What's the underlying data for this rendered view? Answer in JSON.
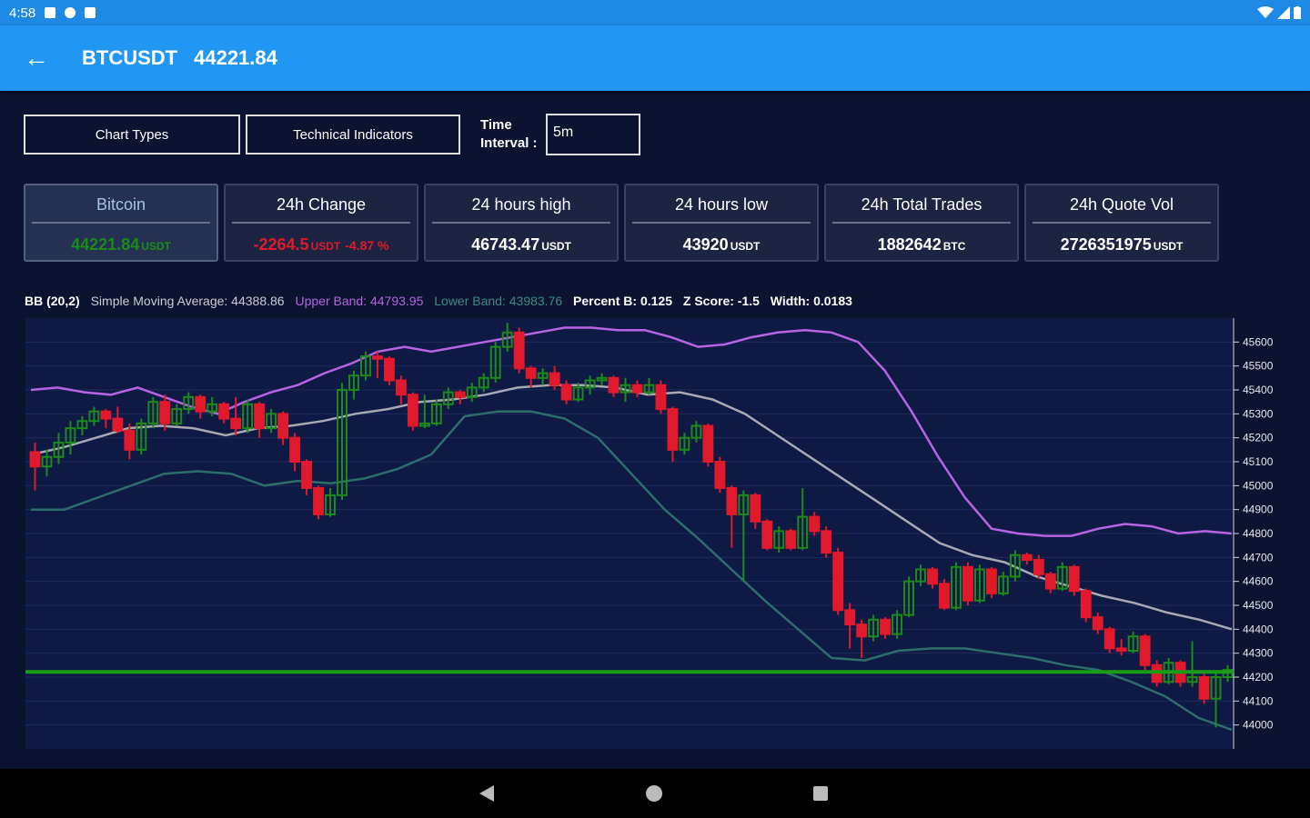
{
  "status_bar": {
    "time": "4:58"
  },
  "app_bar": {
    "symbol": "BTCUSDT",
    "price": "44221.84"
  },
  "toolbar": {
    "chart_types_label": "Chart Types",
    "technical_indicators_label": "Technical Indicators",
    "time_interval_label_line1": "Time",
    "time_interval_label_line2": "Interval :",
    "time_interval_value": "5m"
  },
  "stats": {
    "coin": {
      "title": "Bitcoin",
      "value": "44221.84",
      "unit": "USDT"
    },
    "change": {
      "title": "24h Change",
      "value": "-2264.5",
      "unit": "USDT",
      "percent": "-4.87 %"
    },
    "high": {
      "title": "24 hours high",
      "value": "46743.47",
      "unit": "USDT"
    },
    "low": {
      "title": "24 hours low",
      "value": "43920",
      "unit": "USDT"
    },
    "trades": {
      "title": "24h Total Trades",
      "value": "1882642",
      "unit": "BTC"
    },
    "quote_vol": {
      "title": "24h Quote Vol",
      "value": "2726351975",
      "unit": "USDT"
    }
  },
  "legend": {
    "bb": "BB (20,2)",
    "sma": "Simple Moving Average: 44388.86",
    "upper": "Upper Band: 44793.95",
    "lower": "Lower Band: 43983.76",
    "percent_b": "Percent B: 0.125",
    "z_score": "Z Score: -1.5",
    "width": "Width: 0.0183"
  },
  "colors": {
    "app_bar": "#2196f3",
    "background": "#0c1330",
    "chart_background": "#0e1a44",
    "candle_up": "#1c8a1c",
    "candle_down": "#e01a2c",
    "upper_band": "#b565e2",
    "sma": "#a9a9b3",
    "lower_band": "#2d6e6c",
    "price_line": "#1a9e1a"
  },
  "chart_data": {
    "type": "candlestick",
    "y_ticks": [
      44000,
      44100,
      44200,
      44300,
      44400,
      44500,
      44600,
      44700,
      44800,
      44900,
      45000,
      45100,
      45200,
      45300,
      45400,
      45500,
      45600
    ],
    "ylim": [
      43900,
      45700
    ],
    "current_price_line": 44221.84,
    "grid": true,
    "candles": [
      [
        45140,
        45080,
        45180,
        44980
      ],
      [
        45080,
        45120,
        45150,
        45040
      ],
      [
        45120,
        45180,
        45220,
        45090
      ],
      [
        45180,
        45240,
        45270,
        45130
      ],
      [
        45240,
        45270,
        45290,
        45210
      ],
      [
        45270,
        45310,
        45330,
        45250
      ],
      [
        45310,
        45280,
        45320,
        45240
      ],
      [
        45280,
        45230,
        45330,
        45220
      ],
      [
        45230,
        45150,
        45260,
        45110
      ],
      [
        45150,
        45260,
        45280,
        45130
      ],
      [
        45260,
        45350,
        45370,
        45240
      ],
      [
        45350,
        45260,
        45380,
        45230
      ],
      [
        45260,
        45320,
        45340,
        45250
      ],
      [
        45320,
        45370,
        45390,
        45300
      ],
      [
        45370,
        45310,
        45380,
        45280
      ],
      [
        45310,
        45340,
        45370,
        45290
      ],
      [
        45340,
        45280,
        45350,
        45260
      ],
      [
        45280,
        45240,
        45370,
        45210
      ],
      [
        45240,
        45340,
        45360,
        45220
      ],
      [
        45340,
        45240,
        45350,
        45200
      ],
      [
        45240,
        45300,
        45320,
        45220
      ],
      [
        45300,
        45200,
        45310,
        45170
      ],
      [
        45200,
        45100,
        45220,
        45060
      ],
      [
        45100,
        44990,
        45110,
        44960
      ],
      [
        44990,
        44880,
        45000,
        44860
      ],
      [
        44880,
        44960,
        44990,
        44870
      ],
      [
        44960,
        45400,
        45430,
        44940
      ],
      [
        45400,
        45460,
        45480,
        45360
      ],
      [
        45460,
        45540,
        45560,
        45440
      ],
      [
        45540,
        45530,
        45560,
        45450
      ],
      [
        45530,
        45440,
        45540,
        45420
      ],
      [
        45440,
        45380,
        45460,
        45340
      ],
      [
        45380,
        45250,
        45390,
        45230
      ],
      [
        45250,
        45260,
        45380,
        45240
      ],
      [
        45260,
        45340,
        45360,
        45250
      ],
      [
        45340,
        45390,
        45410,
        45320
      ],
      [
        45390,
        45370,
        45400,
        45340
      ],
      [
        45370,
        45410,
        45430,
        45350
      ],
      [
        45410,
        45450,
        45470,
        45390
      ],
      [
        45450,
        45580,
        45600,
        45430
      ],
      [
        45580,
        45640,
        45680,
        45560
      ],
      [
        45640,
        45490,
        45660,
        45470
      ],
      [
        45490,
        45450,
        45500,
        45410
      ],
      [
        45450,
        45470,
        45490,
        45420
      ],
      [
        45470,
        45420,
        45500,
        45400
      ],
      [
        45420,
        45360,
        45440,
        45340
      ],
      [
        45360,
        45410,
        45430,
        45350
      ],
      [
        45410,
        45440,
        45460,
        45380
      ],
      [
        45440,
        45450,
        45470,
        45420
      ],
      [
        45450,
        45390,
        45460,
        45370
      ],
      [
        45390,
        45420,
        45450,
        45350
      ],
      [
        45420,
        45390,
        45440,
        45370
      ],
      [
        45390,
        45420,
        45450,
        45380
      ],
      [
        45420,
        45320,
        45440,
        45300
      ],
      [
        45320,
        45150,
        45330,
        45100
      ],
      [
        45150,
        45200,
        45220,
        45130
      ],
      [
        45200,
        45250,
        45270,
        45180
      ],
      [
        45250,
        45100,
        45260,
        45080
      ],
      [
        45100,
        44990,
        45120,
        44970
      ],
      [
        44990,
        44880,
        45000,
        44740
      ],
      [
        44880,
        44960,
        44980,
        44600
      ],
      [
        44960,
        44850,
        44970,
        44820
      ],
      [
        44850,
        44740,
        44860,
        44730
      ],
      [
        44740,
        44810,
        44830,
        44720
      ],
      [
        44810,
        44740,
        44820,
        44730
      ],
      [
        44740,
        44870,
        44990,
        44730
      ],
      [
        44870,
        44810,
        44890,
        44790
      ],
      [
        44810,
        44720,
        44830,
        44700
      ],
      [
        44720,
        44480,
        44740,
        44460
      ],
      [
        44480,
        44420,
        44510,
        44320
      ],
      [
        44420,
        44370,
        44440,
        44280
      ],
      [
        44370,
        44440,
        44460,
        44350
      ],
      [
        44440,
        44380,
        44450,
        44360
      ],
      [
        44380,
        44460,
        44480,
        44360
      ],
      [
        44460,
        44600,
        44620,
        44450
      ],
      [
        44600,
        44650,
        44670,
        44580
      ],
      [
        44650,
        44590,
        44660,
        44570
      ],
      [
        44590,
        44490,
        44610,
        44480
      ],
      [
        44490,
        44660,
        44680,
        44480
      ],
      [
        44660,
        44520,
        44680,
        44500
      ],
      [
        44520,
        44650,
        44670,
        44510
      ],
      [
        44650,
        44550,
        44660,
        44530
      ],
      [
        44550,
        44620,
        44640,
        44540
      ],
      [
        44620,
        44710,
        44730,
        44600
      ],
      [
        44710,
        44690,
        44720,
        44670
      ],
      [
        44690,
        44630,
        44710,
        44610
      ],
      [
        44630,
        44570,
        44640,
        44550
      ],
      [
        44570,
        44660,
        44680,
        44560
      ],
      [
        44660,
        44560,
        44670,
        44540
      ],
      [
        44560,
        44450,
        44570,
        44430
      ],
      [
        44450,
        44400,
        44470,
        44380
      ],
      [
        44400,
        44320,
        44410,
        44300
      ],
      [
        44320,
        44310,
        44360,
        44290
      ],
      [
        44310,
        44370,
        44390,
        44300
      ],
      [
        44370,
        44250,
        44380,
        44230
      ],
      [
        44250,
        44180,
        44270,
        44160
      ],
      [
        44180,
        44260,
        44280,
        44170
      ],
      [
        44260,
        44180,
        44270,
        44160
      ],
      [
        44180,
        44200,
        44350,
        44160
      ],
      [
        44200,
        44110,
        44220,
        44090
      ],
      [
        44110,
        44200,
        44220,
        43990
      ],
      [
        44200,
        44230,
        44250,
        44180
      ]
    ],
    "upper_band": [
      45400,
      45410,
      45390,
      45380,
      45410,
      45370,
      45330,
      45300,
      45350,
      45390,
      45420,
      45470,
      45510,
      45560,
      45580,
      45560,
      45580,
      45600,
      45620,
      45640,
      45660,
      45660,
      45650,
      45650,
      45620,
      45580,
      45590,
      45620,
      45640,
      45650,
      45640,
      45600,
      45480,
      45310,
      45120,
      44950,
      44820,
      44800,
      44790,
      44790,
      44820,
      44840,
      44830,
      44800,
      44810,
      44800
    ],
    "sma": [
      45130,
      45160,
      45200,
      45240,
      45250,
      45240,
      45210,
      45240,
      45250,
      45270,
      45300,
      45320,
      45350,
      45360,
      45380,
      45410,
      45420,
      45420,
      45410,
      45380,
      45390,
      45360,
      45300,
      45210,
      45120,
      45030,
      44940,
      44850,
      44760,
      44710,
      44680,
      44620,
      44580,
      44540,
      44510,
      44470,
      44440,
      44400
    ],
    "lower_band": [
      44900,
      44900,
      44950,
      45000,
      45050,
      45060,
      45050,
      45000,
      45020,
      45010,
      45030,
      45070,
      45130,
      45290,
      45310,
      45310,
      45280,
      45200,
      45050,
      44900,
      44780,
      44650,
      44520,
      44400,
      44280,
      44270,
      44310,
      44320,
      44320,
      44300,
      44280,
      44250,
      44230,
      44180,
      44120,
      44030,
      43980
    ]
  }
}
